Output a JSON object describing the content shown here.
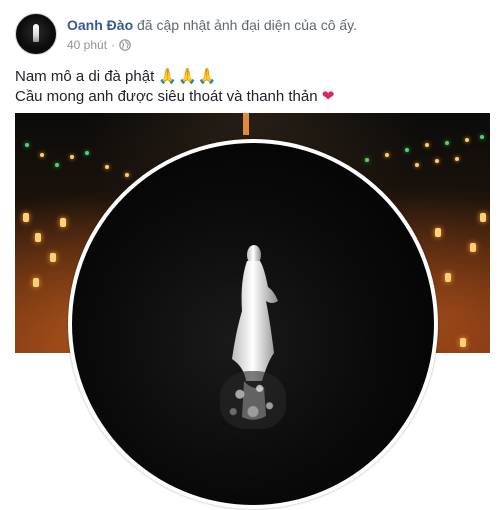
{
  "post": {
    "author": "Oanh Đào",
    "action_text": " đã cập nhật ảnh đại diện của cô ấy.",
    "timestamp": "40 phút",
    "separator": "·",
    "privacy_icon": "globe-icon",
    "caption_line1": "Nam mô a di đà phật",
    "caption_emoji1": "🙏🙏🙏",
    "caption_line2": "Cầu mong anh được siêu thoát và thanh thản",
    "caption_emoji2": "❤",
    "colors": {
      "author": "#385898",
      "meta_text": "#90949c",
      "body_text": "#1d2129",
      "heart": "#e0245e"
    }
  }
}
